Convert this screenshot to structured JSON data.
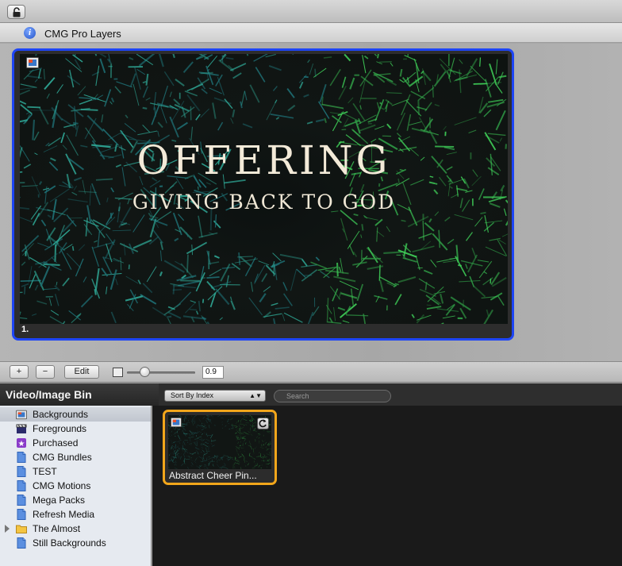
{
  "layers": {
    "title": "CMG Pro Layers",
    "layer": {
      "number": "1.",
      "title": "OFFERING",
      "subtitle": "GIVING BACK TO GOD"
    }
  },
  "toolbar": {
    "add_label": "+",
    "remove_label": "−",
    "edit_label": "Edit",
    "zoom_value": "0.9",
    "zoom_fraction": 0.25
  },
  "bin": {
    "title": "Video/Image Bin",
    "sort_label": "Sort By Index",
    "search_placeholder": "Search",
    "sidebar": [
      {
        "label": "Backgrounds",
        "icon": "media-icon",
        "selected": true
      },
      {
        "label": "Foregrounds",
        "icon": "clapper-icon"
      },
      {
        "label": "Purchased",
        "icon": "purchased-icon"
      },
      {
        "label": "CMG Bundles",
        "icon": "document-icon"
      },
      {
        "label": "TEST",
        "icon": "document-icon"
      },
      {
        "label": "CMG Motions",
        "icon": "document-icon"
      },
      {
        "label": "Mega Packs",
        "icon": "document-icon"
      },
      {
        "label": "Refresh Media",
        "icon": "document-icon"
      },
      {
        "label": "The Almost",
        "icon": "folder-icon",
        "expandable": true
      },
      {
        "label": "Still Backgrounds",
        "icon": "document-icon"
      }
    ],
    "items": [
      {
        "label": "Abstract Cheer Pin..."
      }
    ]
  },
  "colors": {
    "layer_selection": "#1e45f5",
    "item_selection": "#f2a61b",
    "particle_teal": "#2fa896",
    "particle_green": "#3fcf58"
  }
}
